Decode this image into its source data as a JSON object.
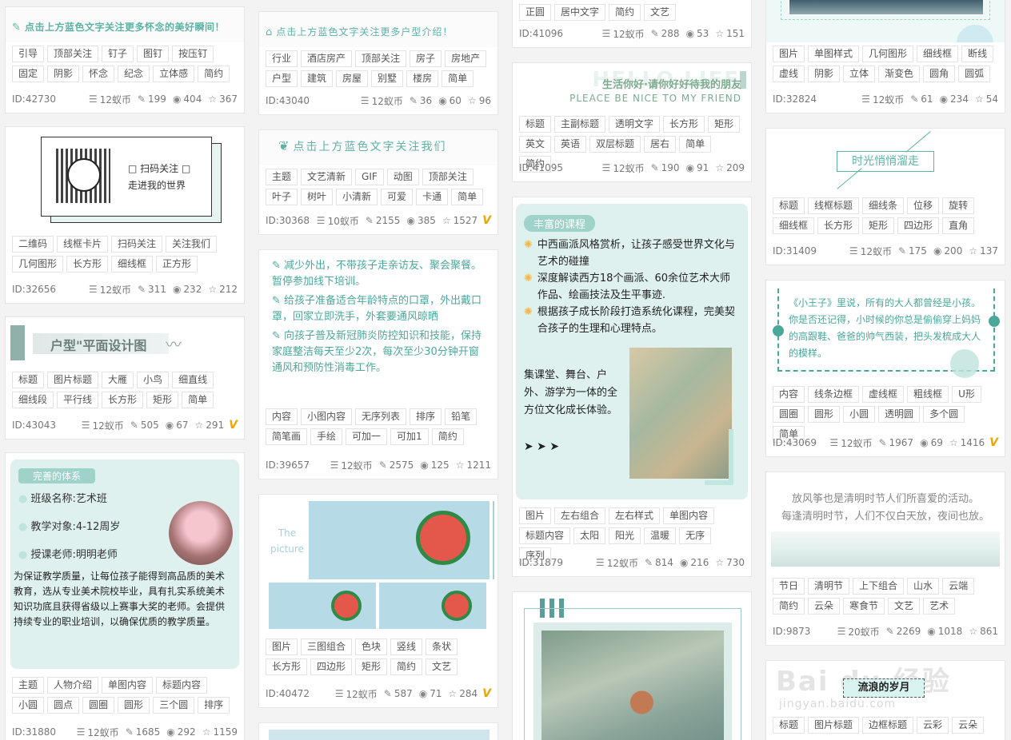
{
  "cards": {
    "c1": {
      "headline": "点击上方蓝色文字关注更多怀念的美好瞬间！",
      "tags": [
        "引导",
        "顶部关注",
        "钉子",
        "图钉",
        "按压钉",
        "固定",
        "阴影",
        "怀念",
        "纪念",
        "立体感",
        "简约"
      ],
      "id": "ID:42730",
      "coins": "12蚁币",
      "edits": "199",
      "views": "404",
      "stars": "367"
    },
    "c2": {
      "qr_line1": "扫码关注",
      "qr_line2": "走进我的世界",
      "tags": [
        "二维码",
        "线框卡片",
        "扫码关注",
        "关注我们",
        "几何图形",
        "长方形",
        "细线框",
        "正方形"
      ],
      "id": "ID:32656",
      "coins": "12蚁币",
      "edits": "311",
      "views": "232",
      "stars": "212"
    },
    "c3": {
      "headline": "户型\"平面设计图",
      "tags": [
        "标题",
        "图片标题",
        "大雁",
        "小鸟",
        "细直线",
        "细线段",
        "平行线",
        "长方形",
        "矩形",
        "简单"
      ],
      "id": "ID:43043",
      "coins": "12蚁币",
      "edits": "505",
      "views": "67",
      "stars": "291",
      "vip": "V"
    },
    "c4": {
      "badge": "完善的体系",
      "items": [
        "班级名称:艺术班",
        "教学对象:4-12周岁",
        "授课老师:明明老师"
      ],
      "body": "为保证教学质量，让每位孩子能得到高品质的美术教育，选从专业美术院校毕业，具有扎实系统美术知识功底且获得省级以上赛事大奖的老师。会提供持续专业的职业培训，以确保优质的教学质量。",
      "tags": [
        "主题",
        "人物介绍",
        "单图内容",
        "标题内容",
        "小圆",
        "圆点",
        "圆圈",
        "圆形",
        "三个圆",
        "排序"
      ],
      "id": "ID:31880",
      "coins": "12蚁币",
      "edits": "1685",
      "views": "292",
      "stars": "1159"
    },
    "c5": {
      "headline": "点击上方蓝色文字关注更多户型介绍！",
      "tags": [
        "行业",
        "酒店房产",
        "顶部关注",
        "房子",
        "房地产",
        "户型",
        "建筑",
        "房屋",
        "别墅",
        "楼房",
        "简单"
      ],
      "id": "ID:43040",
      "coins": "12蚁币",
      "edits": "36",
      "views": "60",
      "stars": "96"
    },
    "c6": {
      "headline": "点击上方蓝色文字关注我们",
      "tags": [
        "主题",
        "文艺清新",
        "GIF",
        "动图",
        "顶部关注",
        "叶子",
        "树叶",
        "小清新",
        "可爱",
        "卡通",
        "简单"
      ],
      "id": "ID:30368",
      "coins": "10蚁币",
      "edits": "2155",
      "views": "385",
      "stars": "1527",
      "vip": "V"
    },
    "c7": {
      "lines": [
        "减少外出，不带孩子走亲访友、聚会聚餐。暂停参加线下培训。",
        "给孩子准备适合年龄特点的口罩，外出戴口罩，回家立即洗手，外套要通风晾晒",
        "向孩子普及新冠肺炎防控知识和技能，保持家庭整洁每天至少2次，每次至少30分钟开窗通风和预防性消毒工作。"
      ],
      "tags": [
        "内容",
        "小图内容",
        "无序列表",
        "排序",
        "铅笔",
        "简笔画",
        "手绘",
        "可加一",
        "可加1",
        "简约"
      ],
      "id": "ID:39657",
      "coins": "12蚁币",
      "edits": "2575",
      "views": "125",
      "stars": "1211"
    },
    "c8": {
      "caption": "The picture",
      "tags": [
        "图片",
        "三图组合",
        "色块",
        "竖线",
        "条状",
        "长方形",
        "四边形",
        "矩形",
        "简约",
        "文艺"
      ],
      "id": "ID:40472",
      "coins": "12蚁币",
      "edits": "587",
      "views": "71",
      "stars": "284",
      "vip": "V"
    },
    "c9": {
      "tags": [
        "正圆",
        "居中文字",
        "简约",
        "文艺"
      ],
      "id": "ID:41096",
      "coins": "12蚁币",
      "edits": "288",
      "views": "53",
      "stars": "151"
    },
    "c10": {
      "bg_text": "HELLO LIFE",
      "line1": "生活你好·请你好好待我的朋友",
      "line2": "PLEACE BE NICE TO MY FRIEND",
      "tags": [
        "标题",
        "主副标题",
        "透明文字",
        "长方形",
        "矩形",
        "英文",
        "英语",
        "双层标题",
        "居右",
        "简单",
        "简约"
      ],
      "id": "ID:41095",
      "coins": "12蚁币",
      "edits": "190",
      "views": "91",
      "stars": "209"
    },
    "c11": {
      "badge": "丰富的课程",
      "items": [
        "中西画派风格赏析，让孩子感受世界文化与艺术的碰撞",
        "深度解读西方18个画派、60余位艺术大师作品、绘画技法及生平事迹.",
        "根据孩子成长阶段打造系统化课程，完美契合孩子的生理和心理特点。"
      ],
      "body": "集课堂、舞台、户外、游学为一体的全方位文化成长体验。",
      "tags": [
        "图片",
        "左右组合",
        "左右样式",
        "单图内容",
        "标题内容",
        "太阳",
        "阳光",
        "温暖",
        "无序",
        "序列"
      ],
      "id": "ID:31879",
      "coins": "12蚁币",
      "edits": "814",
      "views": "216",
      "stars": "730"
    },
    "c12": {},
    "c13": {
      "tags": [
        "图片",
        "单图样式",
        "几何图形",
        "细线框",
        "断线",
        "虚线",
        "阴影",
        "立体",
        "渐变色",
        "圆角",
        "圆弧"
      ],
      "id": "ID:32824",
      "coins": "12蚁币",
      "edits": "61",
      "views": "234",
      "stars": "54"
    },
    "c14": {
      "title": "时光悄悄溜走",
      "tags": [
        "标题",
        "线框标题",
        "细线条",
        "位移",
        "旋转",
        "细线框",
        "长方形",
        "矩形",
        "四边形",
        "直角"
      ],
      "id": "ID:31409",
      "coins": "12蚁币",
      "edits": "175",
      "views": "200",
      "stars": "137"
    },
    "c15": {
      "text": "《小王子》里说，所有的大人都曾经是小孩。你是否还记得，小时候的你总是偷偷穿上妈妈的高跟鞋、爸爸的帅气西装，把头发梳成大人的模样。",
      "tags": [
        "内容",
        "线条边框",
        "虚线框",
        "粗线框",
        "U形",
        "圆圈",
        "圆形",
        "小圆",
        "透明圆",
        "多个圆",
        "简单"
      ],
      "id": "ID:43069",
      "coins": "12蚁币",
      "edits": "1967",
      "views": "69",
      "stars": "1416",
      "vip": "V"
    },
    "c16": {
      "line1": "放风筝也是清明时节人们所喜爱的活动。",
      "line2": "每逢清明时节，人们不仅白天放，夜间也放。",
      "tags": [
        "节日",
        "清明节",
        "上下组合",
        "山水",
        "云端",
        "简约",
        "云朵",
        "寒食节",
        "文艺",
        "艺术"
      ],
      "id": "ID:9873",
      "coins": "20蚁币",
      "edits": "2269",
      "views": "1018",
      "stars": "861"
    },
    "c17": {
      "title": "流浪的岁月",
      "watermark": "Bai du 经验",
      "watermark_sub": "jingyan.baidu.com",
      "tags": [
        "标题",
        "图片标题",
        "边框标题",
        "云彩",
        "云朵"
      ]
    }
  },
  "colors": {
    "accent": "#4aa89b",
    "mint": "#dff1ee",
    "vip": "#f0a400"
  }
}
